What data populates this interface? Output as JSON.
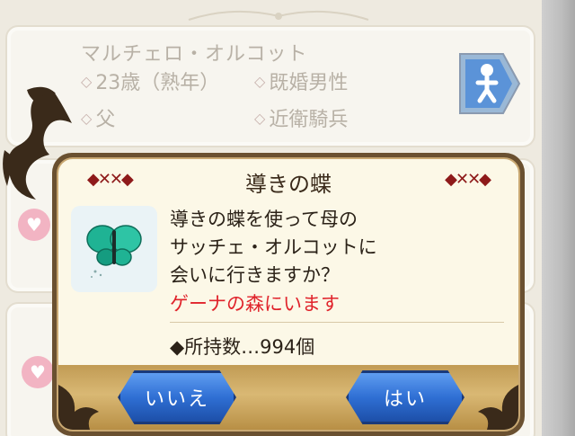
{
  "background": {
    "character": {
      "name": "マルチェロ・オルコット",
      "attributes": [
        "23歳（熟年）",
        "既婚男性",
        "父",
        "近衛騎兵"
      ]
    },
    "icons": {
      "profile_button": "person-icon",
      "heart": "heart-icon"
    }
  },
  "dialog": {
    "title": "導きの蝶",
    "message_lines": [
      "導きの蝶を使って母の",
      "サッチェ・オルコットに",
      "会いに行きますか？"
    ],
    "location": "ゲーナの森にいます",
    "owned": "◆所持数…994個",
    "buttons": {
      "no": "いいえ",
      "yes": "はい"
    }
  },
  "colors": {
    "accent_red": "#e0232b",
    "button_blue": "#2f6fd4",
    "dialog_border": "#6a5030",
    "dialog_bg": "#fcf8e7"
  }
}
